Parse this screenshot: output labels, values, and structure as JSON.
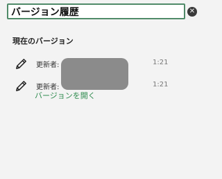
{
  "header": {
    "title": "バージョン履歴",
    "close_icon": "close-icon",
    "close_symbol": "✕"
  },
  "section": {
    "title": "現在のバージョン"
  },
  "versions": [
    {
      "editor_label": "更新者:",
      "time": "1:21",
      "icon": "pencil-icon"
    },
    {
      "editor_label": "更新者:",
      "time": "1:21",
      "icon": "pencil-icon",
      "open_label": "バージョンを開く"
    }
  ],
  "colors": {
    "accent_border": "#4f8a68",
    "link": "#2e8b4e",
    "redaction": "#8b8b8b"
  }
}
